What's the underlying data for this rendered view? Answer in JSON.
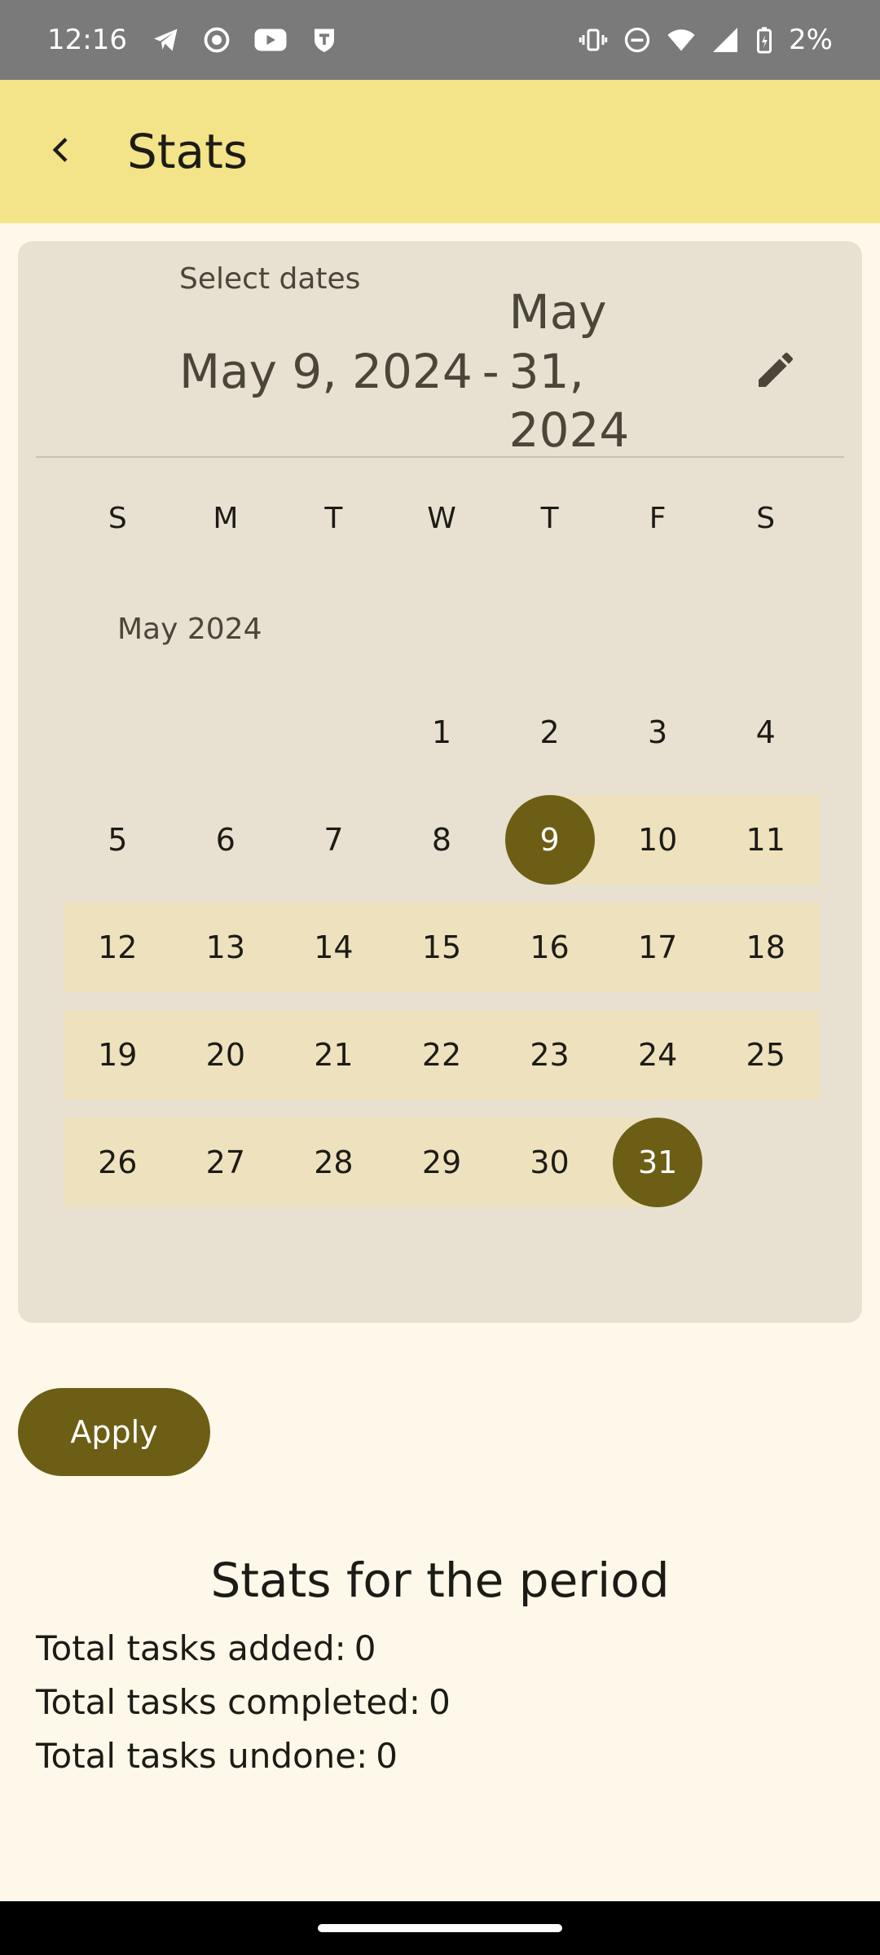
{
  "status_bar": {
    "time": "12:16",
    "battery": "2%",
    "left_icons": [
      "telegram-icon",
      "record-icon",
      "youtube-icon",
      "shield-icon"
    ],
    "right_icons": [
      "vibrate-icon",
      "dnd-icon",
      "wifi-icon",
      "signal-icon",
      "battery-icon"
    ]
  },
  "app_bar": {
    "title": "Stats",
    "color": "#F3E389"
  },
  "date_picker": {
    "label": "Select dates",
    "range_start": "May 9, 2024",
    "range_separator": "-",
    "range_end": "May 31, 2024",
    "weekdays": [
      "S",
      "M",
      "T",
      "W",
      "T",
      "F",
      "S"
    ],
    "month_label": "May 2024",
    "weeks": [
      [
        "",
        "",
        "",
        "1",
        "2",
        "3",
        "4"
      ],
      [
        "5",
        "6",
        "7",
        "8",
        "9",
        "10",
        "11"
      ],
      [
        "12",
        "13",
        "14",
        "15",
        "16",
        "17",
        "18"
      ],
      [
        "19",
        "20",
        "21",
        "22",
        "23",
        "24",
        "25"
      ],
      [
        "26",
        "27",
        "28",
        "29",
        "30",
        "31",
        ""
      ]
    ],
    "selected_start": "9",
    "selected_end": "31",
    "accent_color": "#6C5E14",
    "range_color": "#EDE2BD"
  },
  "apply_label": "Apply",
  "stats": {
    "title": "Stats for the period",
    "lines": [
      {
        "label": "Total tasks added:",
        "value": "0"
      },
      {
        "label": "Total tasks completed:",
        "value": "0"
      },
      {
        "label": "Total tasks undone:",
        "value": "0"
      }
    ]
  }
}
